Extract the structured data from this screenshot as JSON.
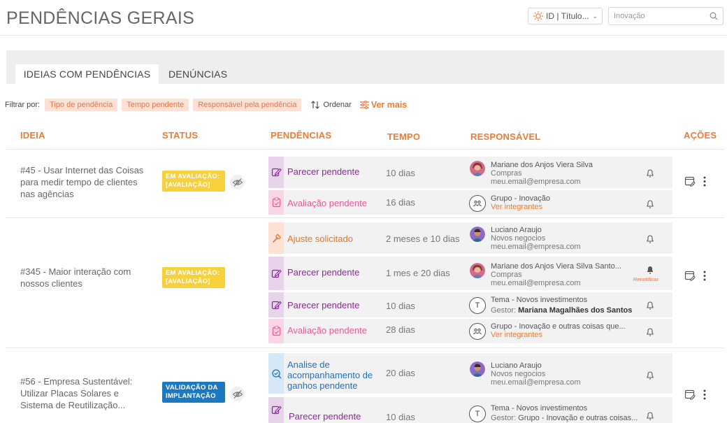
{
  "header": {
    "title": "PENDÊNCIAS GERAIS",
    "field_select": "ID | Título...",
    "search_placeholder": "Inovação"
  },
  "tabs": [
    {
      "label": "IDEIAS COM PENDÊNCIAS",
      "active": true
    },
    {
      "label": "DENÚNCIAS",
      "active": false
    }
  ],
  "filters": {
    "label": "Filtrar por:",
    "chips": [
      "Tipo de pendência",
      "Tempo pendente",
      "Responsável pela pendência"
    ],
    "order_label": "Ordenar",
    "more_label": "Ver mais"
  },
  "columns": {
    "idea": "IDEIA",
    "status": "STATUS",
    "pendencias": "PENDÊNCIAS",
    "tempo": "TEMPO",
    "responsavel": "RESPONSÁVEL",
    "acoes": "AÇÕES"
  },
  "colors": {
    "accent": "#f07b32",
    "purple": "#8a2b98",
    "pink": "#ea5996",
    "blue": "#2371b9",
    "yellow_badge": "#f8d03a",
    "blue_badge": "#1c79c0"
  },
  "ideas": [
    {
      "title": "#45 - Usar Internet das Coisas para medir tempo de clientes nas agências",
      "status": "EM AVALIAÇÃO: [AVALIAÇÃO]",
      "status_color": "yellow",
      "hidden_icon": true,
      "pendencias": [
        {
          "label": "Parecer pendente",
          "tipo": "purple",
          "icon": "edit-icon",
          "tempo": "10 dias",
          "resp": {
            "avatar": "photo-woman",
            "line1": "Mariane dos Anjos Viera Silva",
            "line2": "Compras",
            "line3": "meu.email@empresa.com"
          }
        },
        {
          "label": "Avaliação pendente",
          "tipo": "pink",
          "icon": "clipboard-icon",
          "tempo": "16 dias",
          "resp": {
            "avatar": "group",
            "line1": "Grupo - Inovação",
            "link": "Ver integrantes"
          }
        }
      ]
    },
    {
      "title": "#345 - Maior interação com nossos clientes",
      "status": "EM AVALIAÇÃO: [AVALIAÇÃO]",
      "status_color": "yellow",
      "hidden_icon": false,
      "pendencias": [
        {
          "label": "Ajuste solicitado",
          "tipo": "orange",
          "icon": "wrench-icon",
          "tempo": "2 meses e 10 dias",
          "resp": {
            "avatar": "photo-man",
            "line1": "Luciano Araujo",
            "line2": "Novos negocios",
            "line3": "meu.email@empresa.com"
          }
        },
        {
          "label": "Parecer pendente",
          "tipo": "purple",
          "icon": "edit-icon",
          "tempo": "1 mes e 20 dias",
          "resp": {
            "avatar": "photo-woman",
            "line1": "Mariane dos Anjos Viera Silva Santo...",
            "line2": "Compras",
            "line3": "meu.email@empresa.com",
            "renotify": "Renotificar"
          }
        },
        {
          "label": "Parecer pendente",
          "tipo": "purple",
          "icon": "edit-icon",
          "tempo": "10 dias",
          "resp": {
            "avatar": "T",
            "line1": "Tema - Novos investimentos",
            "gestor_label": "Gestor:",
            "gestor": "Mariana Magalhães dos Santos"
          }
        },
        {
          "label": "Avaliação pendente",
          "tipo": "pink",
          "icon": "clipboard-icon",
          "tempo": "28 dias",
          "resp": {
            "avatar": "group",
            "line1": "Grupo - Inovação e outras coisas que...",
            "link": "Ver integrantes"
          }
        }
      ]
    },
    {
      "title": "#56 - Empresa Sustentável: Utilizar Placas Solares e Sistema de Reutilização...",
      "status": "VALIDAÇÃO DA IMPLANTAÇÃO",
      "status_color": "blue",
      "hidden_icon": true,
      "pendencias": [
        {
          "label": "Analise de acompanhamento de ganhos pendente",
          "tipo": "blue",
          "icon": "search-check-icon",
          "tempo": "20 dias",
          "resp": {
            "avatar": "photo-man",
            "line1": "Luciano Araujo",
            "line2": "Novos negocios",
            "line3": "meu.email@empresa.com"
          }
        },
        {
          "label": "Parecer pendente",
          "tipo": "purple",
          "icon": "edit-icon",
          "tempo": "10 dias",
          "resp": {
            "avatar": "T",
            "line1": "Tema - Novos investimentos",
            "gestor_label": "Gestor:",
            "gestor": "Grupo - Inovação e outras coisas..."
          }
        }
      ]
    }
  ]
}
